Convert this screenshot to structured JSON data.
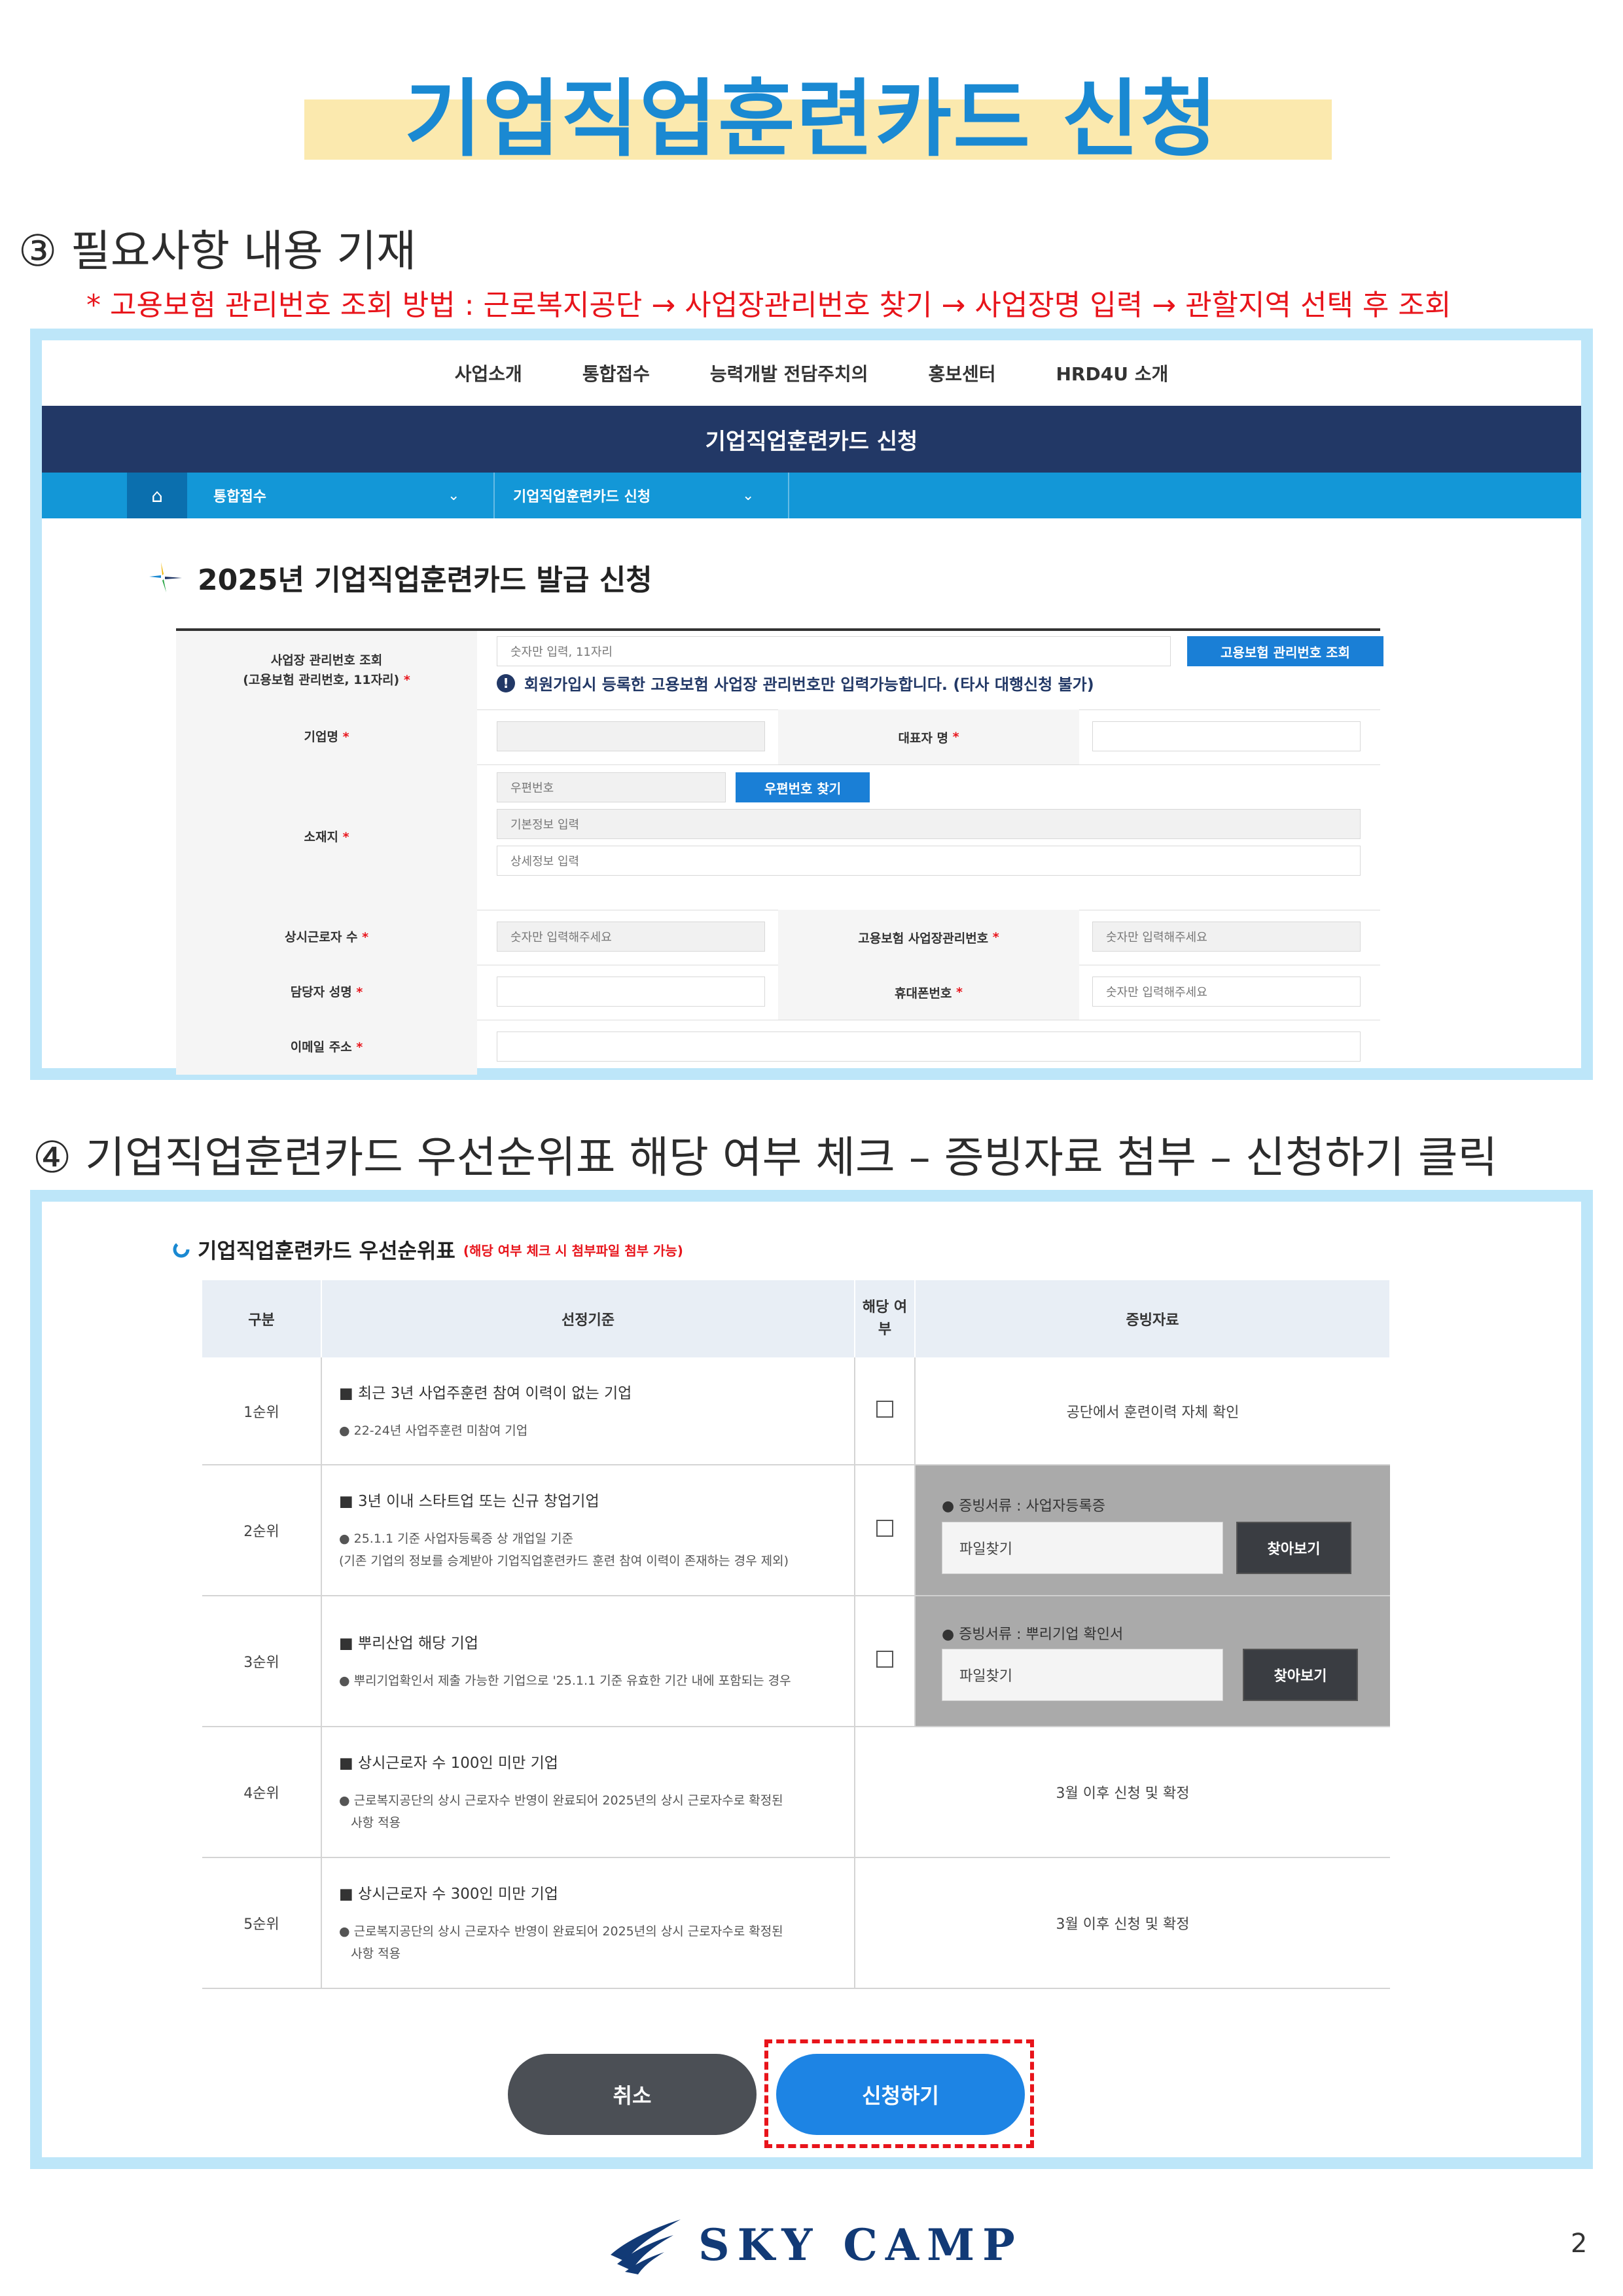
{
  "title": "기업직업훈련카드 신청",
  "step3": {
    "heading": "③  필요사항 내용 기재",
    "note": "* 고용보험 관리번호 조회 방법 : 근로복지공단 → 사업장관리번호 찾기 → 사업장명 입력 → 관할지역 선택 후 조회"
  },
  "site": {
    "nav": [
      "사업소개",
      "통합접수",
      "능력개발 전담주치의",
      "홍보센터",
      "HRD4U 소개"
    ],
    "banner": "기업직업훈련카드 신청",
    "breadcrumb": [
      "통합접수",
      "기업직업훈련카드 신청"
    ]
  },
  "form": {
    "section_title": "2025년 기업직업훈련카드 발급 신청",
    "biz_lookup_label_1": "사업장 관리번호 조회",
    "biz_lookup_label_2": "(고용보험 관리번호, 11자리)",
    "biz_lookup_placeholder": "숫자만 입력, 11자리",
    "biz_lookup_button": "고용보험 관리번호 조회",
    "biz_lookup_info": "회원가입시 등록한 고용보험 사업장 관리번호만 입력가능합니다. (타사 대행신청 불가)",
    "company_label": "기업명",
    "ceo_label": "대표자 명",
    "address_label": "소재지",
    "postcode_placeholder": "우편번호",
    "postcode_button": "우편번호 찾기",
    "address_basic_placeholder": "기본정보 입력",
    "address_detail_placeholder": "상세정보 입력",
    "employees_label": "상시근로자 수",
    "employees_placeholder": "숫자만 입력해주세요",
    "insurance_label": "고용보험 사업장관리번호",
    "insurance_placeholder": "숫자만 입력해주세요",
    "manager_label": "담당자 성명",
    "mobile_label": "휴대폰번호",
    "mobile_placeholder": "숫자만 입력해주세요",
    "email_label": "이메일 주소",
    "required_mark": "*"
  },
  "step4": {
    "heading": "④ 기업직업훈련카드 우선순위표 해당 여부 체크 – 증빙자료 첨부 – 신청하기 클릭"
  },
  "priority": {
    "title": "기업직업훈련카드 우선순위표",
    "subtitle": "(해당 여부 체크 시 첨부파일 첨부 가능)",
    "headers": [
      "구분",
      "선정기준",
      "해당 여부",
      "증빙자료"
    ],
    "rows": [
      {
        "rank": "1순위",
        "main": "■ 최근 3년 사업주훈련 참여 이력이 없는 기업",
        "sub": "● 22-24년 사업주훈련 미참여 기업",
        "evidence": "공단에서 훈련이력 자체 확인"
      },
      {
        "rank": "2순위",
        "main": "■ 3년 이내 스타트업 또는 신규 창업기업",
        "sub": "● 25.1.1 기준 사업자등록증 상 개업일 기준",
        "sub2": "(기존 기업의 정보를 승계받아 기업직업훈련카드 훈련 참여 이력이 존재하는 경우 제외)",
        "evidence_label": "● 증빙서류 : 사업자등록증",
        "file_label": "파일찾기",
        "browse": "찾아보기"
      },
      {
        "rank": "3순위",
        "main": "■ 뿌리산업 해당 기업",
        "sub": "● 뿌리기업확인서 제출 가능한 기업으로 '25.1.1 기준 유효한 기간 내에 포함되는 경우",
        "evidence_label": "● 증빙서류 : 뿌리기업 확인서",
        "file_label": "파일찾기",
        "browse": "찾아보기"
      },
      {
        "rank": "4순위",
        "main": "■ 상시근로자 수 100인 미만 기업",
        "sub": "● 근로복지공단의 상시 근로자수 반영이 완료되어 2025년의 상시 근로자수로 확정된",
        "sub2": "사항 적용",
        "evidence": "3월 이후 신청 및 확정"
      },
      {
        "rank": "5순위",
        "main": "■ 상시근로자 수 300인 미만 기업",
        "sub": "● 근로복지공단의 상시 근로자수 반영이 완료되어 2025년의 상시 근로자수로 확정된",
        "sub2": "사항 적용",
        "evidence": "3월 이후 신청 및 확정"
      }
    ],
    "cancel_label": "취소",
    "apply_label": "신청하기"
  },
  "footer": {
    "logo_text": "SKY CAMP",
    "page_number": "2"
  },
  "colors": {
    "title_blue": "#1a89d2",
    "highlight": "#fbe9ae",
    "note_red": "#e8141b",
    "frame": "#bde6f9",
    "banner_navy": "#223866",
    "crumb_blue": "#1397d7",
    "button_blue": "#1d84e4"
  }
}
